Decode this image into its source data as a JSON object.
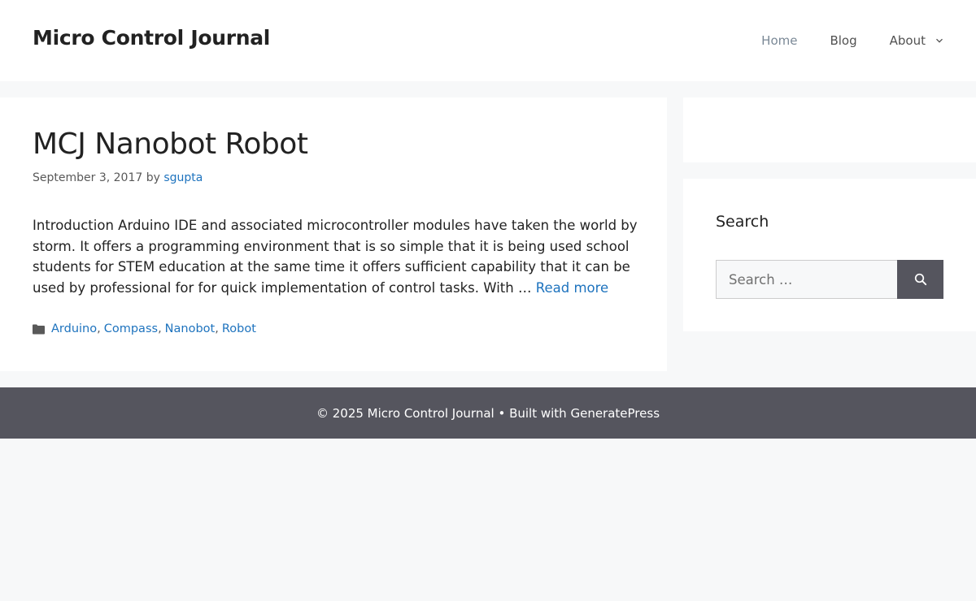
{
  "header": {
    "site_title": "Micro Control Journal",
    "nav": [
      {
        "label": "Home",
        "current": true
      },
      {
        "label": "Blog"
      },
      {
        "label": "About",
        "has_dropdown": true
      }
    ]
  },
  "article": {
    "title": "MCJ Nanobot Robot",
    "date": "September 3, 2017",
    "by": "by",
    "author": "sgupta",
    "summary": "Introduction Arduino IDE and associated microcontroller modules have taken the world by storm. It offers a programming environment that is so simple that it is being used school students for STEM education at the same  time it offers sufficient capability that it can be used by professional for for quick implementation of control tasks. With …",
    "read_more": "Read more",
    "categories": [
      "Arduino",
      "Compass",
      "Nanobot",
      "Robot"
    ],
    "category_icon": "folder-icon"
  },
  "sidebar": {
    "search_widget": {
      "title": "Search",
      "placeholder": "Search …",
      "button_icon": "search-icon"
    }
  },
  "footer": {
    "copyright_prefix": "© 2025 Micro Control Journal • Built with",
    "builder": "GeneratePress"
  },
  "colors": {
    "link": "#1e73be",
    "footer_bg": "#55555e",
    "page_bg": "#f7f8f9"
  }
}
